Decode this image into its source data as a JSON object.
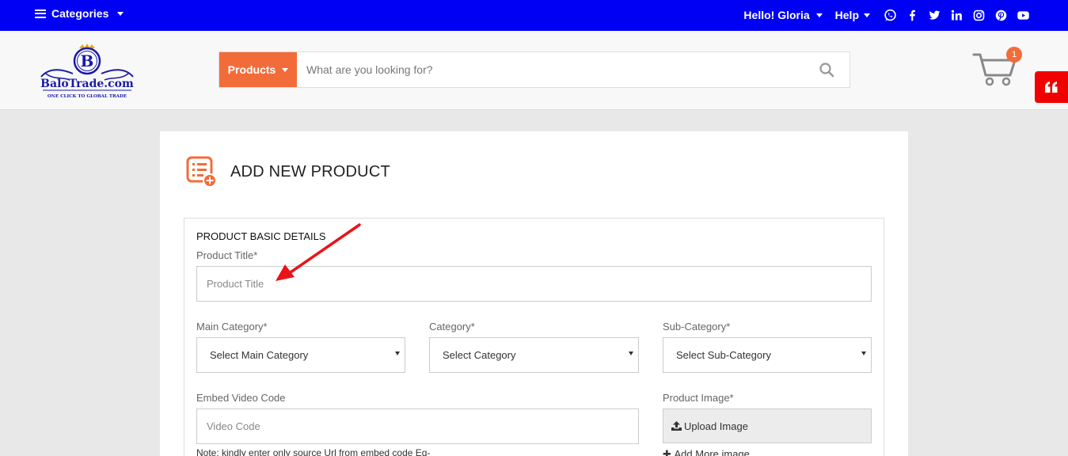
{
  "topbar": {
    "categories_label": "Categories",
    "greeting": "Hello! Gloria",
    "help_label": "Help",
    "social_icons": [
      "whatsapp-icon",
      "facebook-icon",
      "twitter-icon",
      "linkedin-icon",
      "instagram-icon",
      "pinterest-icon",
      "youtube-icon"
    ]
  },
  "header": {
    "logo_text": "BaloTrade.com",
    "logo_letter": "B",
    "logo_tagline": "ONE CLICK TO GLOBAL TRADE",
    "search": {
      "scope_label": "Products",
      "placeholder": "What are you looking for?"
    },
    "cart_count": "1"
  },
  "colors": {
    "topbar_bg": "#0000f5",
    "accent": "#f26c3a",
    "quote_tab": "#f00000"
  },
  "page": {
    "title": "ADD NEW PRODUCT",
    "section_title": "PRODUCT BASIC DETAILS",
    "form": {
      "product_title_label": "Product Title*",
      "product_title_placeholder": "Product Title",
      "main_category_label": "Main Category*",
      "main_category_value": "Select Main Category",
      "category_label": "Category*",
      "category_value": "Select Category",
      "sub_category_label": "Sub-Category*",
      "sub_category_value": "Select Sub-Category",
      "video_label": "Embed Video Code",
      "video_placeholder": "Video Code",
      "video_note": "Note: kindly enter only source Url from embed code Eg-",
      "image_label": "Product Image*",
      "upload_label": "Upload Image",
      "add_more_label": "Add More image"
    }
  }
}
